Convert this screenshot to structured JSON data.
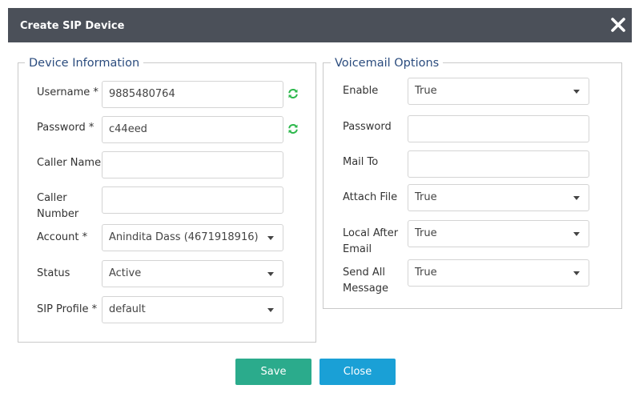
{
  "dialog": {
    "title": "Create SIP Device"
  },
  "device_info": {
    "legend": "Device Information",
    "username": {
      "label": "Username *",
      "value": "9885480764"
    },
    "password": {
      "label": "Password *",
      "value": "c44eed"
    },
    "caller_name": {
      "label": "Caller Name",
      "value": ""
    },
    "caller_number": {
      "label_line1": "Caller",
      "label_line2": "Number",
      "value": ""
    },
    "account": {
      "label": "Account *",
      "value": "Anindita Dass (4671918916)"
    },
    "status": {
      "label": "Status",
      "value": "Active"
    },
    "sip_profile": {
      "label": "SIP Profile *",
      "value": "default"
    }
  },
  "voicemail": {
    "legend": "Voicemail Options",
    "enable": {
      "label": "Enable",
      "value": "True"
    },
    "password": {
      "label": "Password",
      "value": ""
    },
    "mail_to": {
      "label": "Mail To",
      "value": ""
    },
    "attach_file": {
      "label": "Attach File",
      "value": "True"
    },
    "local_after_email": {
      "label_line1": "Local After",
      "label_line2": "Email",
      "value": "True"
    },
    "send_all_message": {
      "label_line1": "Send All",
      "label_line2": "Message",
      "value": "True"
    }
  },
  "buttons": {
    "save": "Save",
    "close": "Close"
  },
  "colors": {
    "titlebar": "#4b5059",
    "legend_text": "#2b4c7e",
    "save_button": "#2bab8c",
    "close_button": "#1aa0d6",
    "refresh_icon": "#2db84c"
  },
  "icons": {
    "close": "close-icon",
    "refresh": "refresh-icon",
    "dropdown": "chevron-down-icon"
  }
}
